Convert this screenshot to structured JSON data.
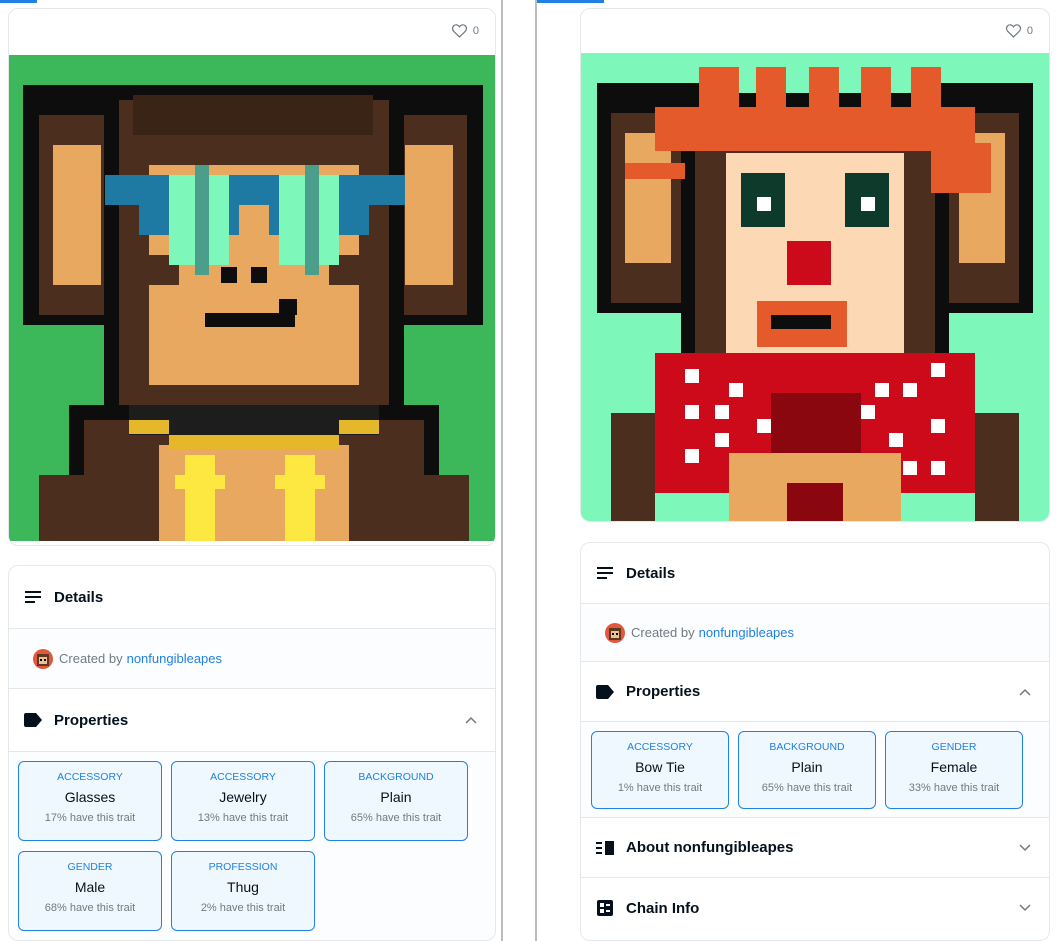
{
  "left": {
    "likes": "0",
    "details_label": "Details",
    "created_prefix": "Created by",
    "creator": "nonfungibleapes",
    "properties_label": "Properties",
    "traits": [
      {
        "type": "ACCESSORY",
        "value": "Glasses",
        "rarity": "17% have this trait"
      },
      {
        "type": "ACCESSORY",
        "value": "Jewelry",
        "rarity": "13% have this trait"
      },
      {
        "type": "BACKGROUND",
        "value": "Plain",
        "rarity": "65% have this trait"
      },
      {
        "type": "GENDER",
        "value": "Male",
        "rarity": "68% have this trait"
      },
      {
        "type": "PROFESSION",
        "value": "Thug",
        "rarity": "2% have this trait"
      }
    ]
  },
  "right": {
    "likes": "0",
    "details_label": "Details",
    "created_prefix": "Created by",
    "creator": "nonfungibleapes",
    "properties_label": "Properties",
    "traits": [
      {
        "type": "ACCESSORY",
        "value": "Bow Tie",
        "rarity": "1% have this trait"
      },
      {
        "type": "BACKGROUND",
        "value": "Plain",
        "rarity": "65% have this trait"
      },
      {
        "type": "GENDER",
        "value": "Female",
        "rarity": "33% have this trait"
      }
    ],
    "about_label": "About nonfungibleapes",
    "chain_label": "Chain Info"
  },
  "colors": {
    "left_background": "#3cb85a",
    "right_background": "#7ef7ba",
    "accent": "#2081e2"
  },
  "icons": [
    "heart-icon",
    "details-icon",
    "tag-icon",
    "chevron-up-icon",
    "chevron-down-icon",
    "about-icon",
    "chain-info-icon"
  ]
}
